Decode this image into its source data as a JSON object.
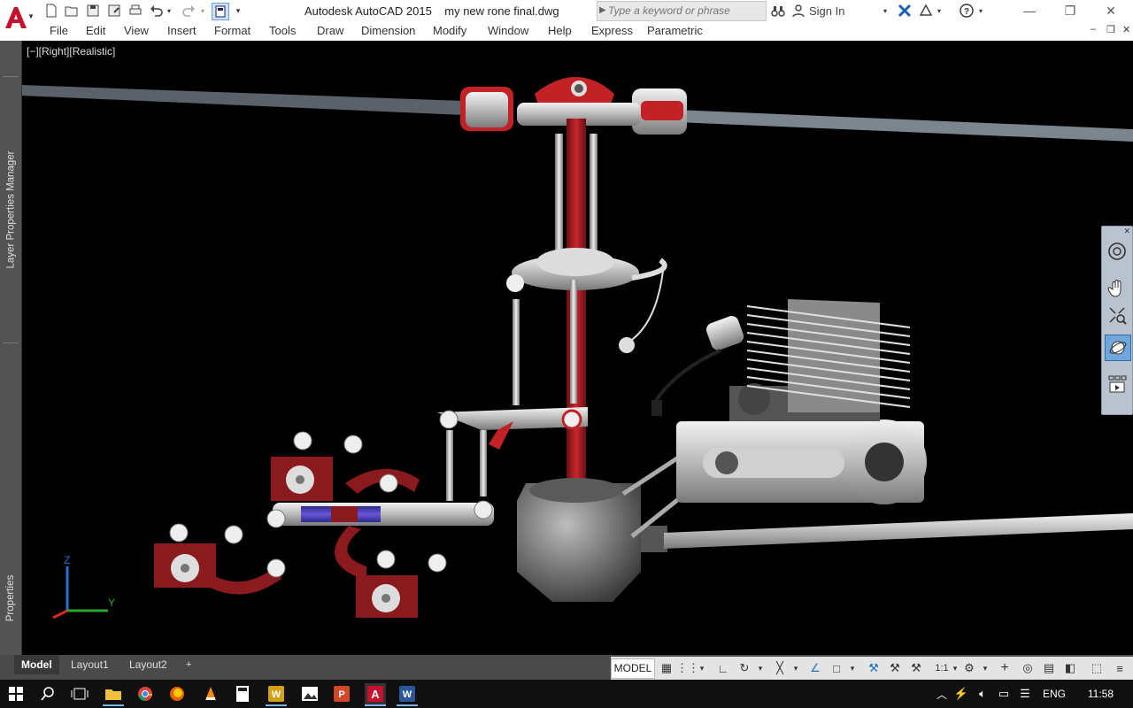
{
  "window": {
    "title": "Autodesk AutoCAD 2015    my new rone final.dwg",
    "minimize": "—",
    "restore": "❐",
    "close": "✕"
  },
  "search": {
    "placeholder": "Type a keyword or phrase"
  },
  "account": {
    "sign_in": "Sign In"
  },
  "menu": [
    "File",
    "Edit",
    "View",
    "Insert",
    "Format",
    "Tools",
    "Draw",
    "Dimension",
    "Modify",
    "Window",
    "Help",
    "Express",
    "Parametric"
  ],
  "viewport": {
    "label": "[−][Right][Realistic]"
  },
  "palettes": {
    "layer_properties": "Layer Properties Manager",
    "properties": "Properties"
  },
  "ucs": {
    "z": "Z",
    "y": "Y"
  },
  "layout_tabs": [
    "Model",
    "Layout1",
    "Layout2",
    "+"
  ],
  "status_bar": {
    "model": "MODEL",
    "scale": "1:1"
  },
  "taskbar": {
    "language": "ENG",
    "time": "11:58"
  },
  "colors": {
    "accent_red": "#a81c22",
    "drawing_bg": "#000000",
    "title_bg": "#ffffff",
    "status_blue": "#1e73be"
  }
}
